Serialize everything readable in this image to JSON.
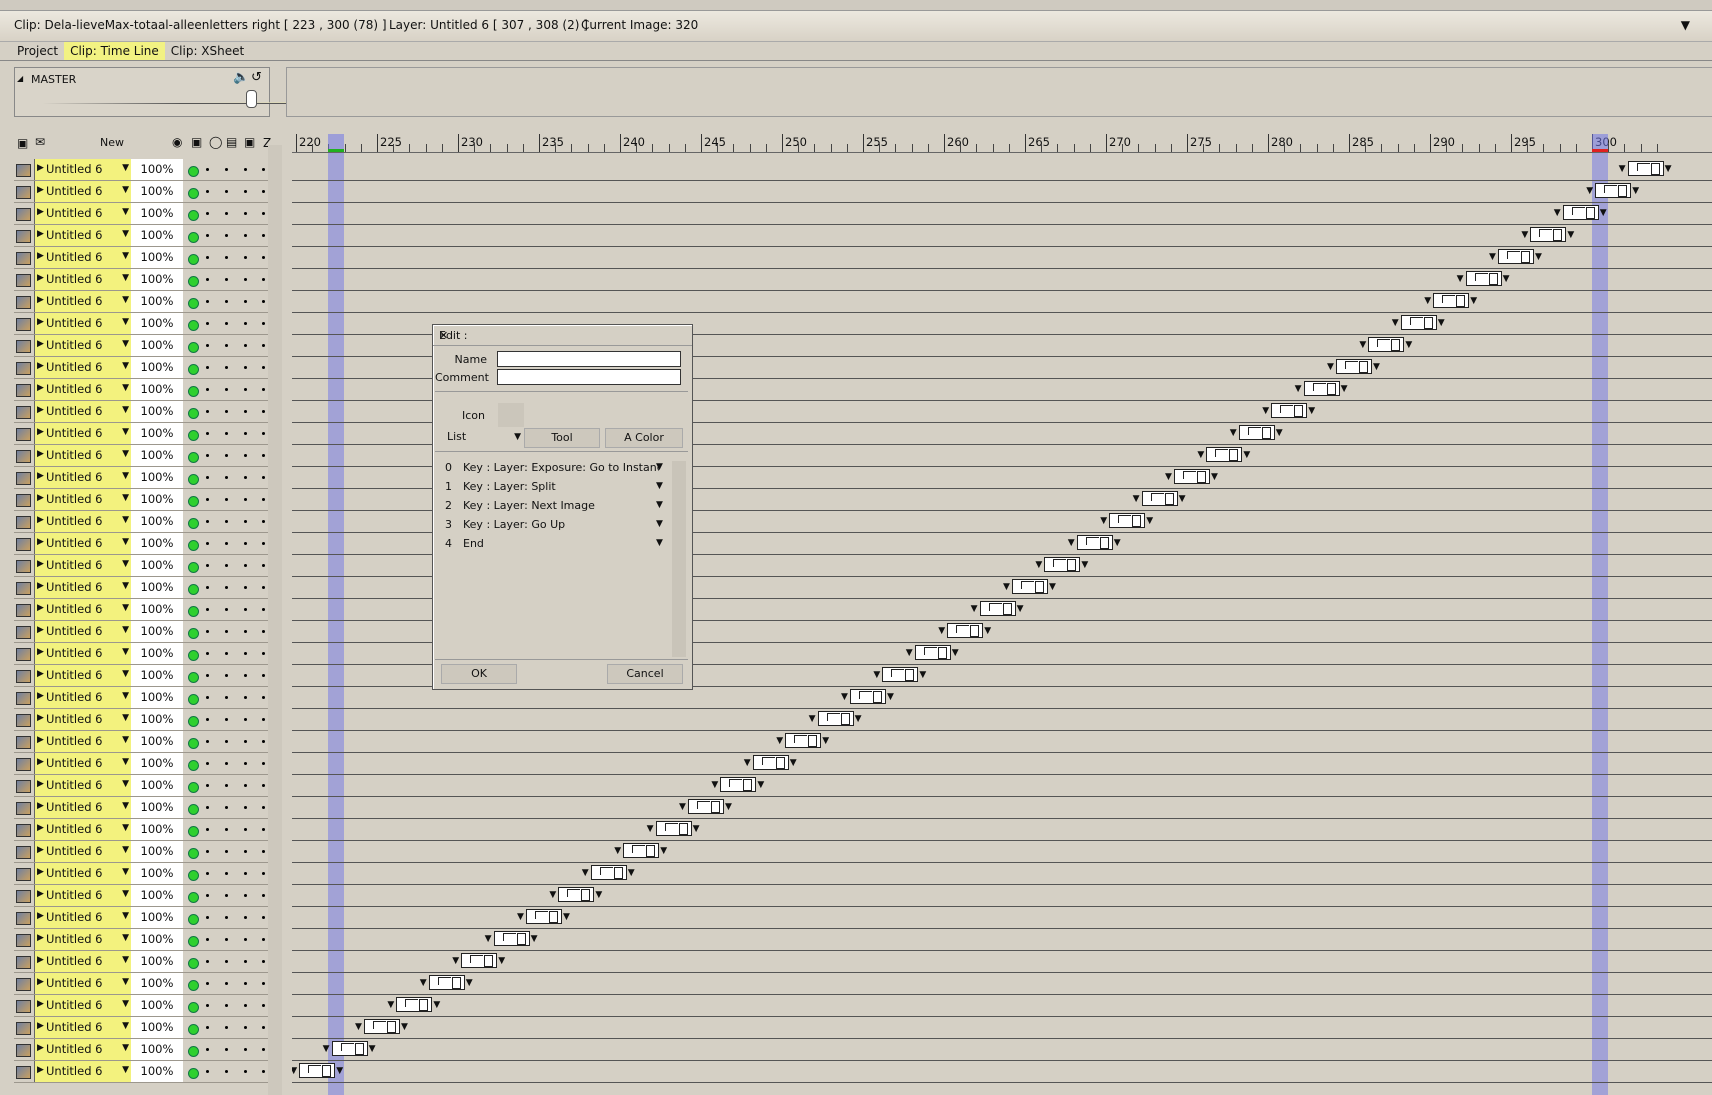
{
  "titlebar": {
    "clip": "Clip: Dela-lieveMax-totaal-alleenletters right [ 223 , 300  (78) ]",
    "layer": "Layer: Untitled 6 [ 307 , 308  (2) ]",
    "current_image": "Current Image: 320"
  },
  "tabs": [
    "Project",
    "Clip: Time Line",
    "Clip: XSheet"
  ],
  "active_tab": 1,
  "master": {
    "label": "MASTER",
    "volume": 1.0
  },
  "layer_header": {
    "new_label": "New",
    "z_label": "Z"
  },
  "layer_row": {
    "name": "Untitled 6",
    "opacity": "100%"
  },
  "layer_count": 42,
  "ruler": {
    "start": 220,
    "end": 300,
    "step": 5,
    "labels": [
      "220",
      "225",
      "230",
      "235",
      "240",
      "245",
      "250",
      "255",
      "260",
      "265",
      "270",
      "275",
      "280",
      "285",
      "290",
      "295",
      "300"
    ]
  },
  "markers": {
    "in_frame": 222,
    "out_frame": 300,
    "in_color": "#20b020",
    "out_color": "#e02020",
    "band_color": "#6f74e8"
  },
  "dialog": {
    "title": "Edit :",
    "name_label": "Name",
    "comment_label": "Comment",
    "name_value": "",
    "comment_value": "",
    "icon_label": "Icon",
    "list_label": "List",
    "tool_label": "Tool",
    "acolor_label": "A Color",
    "actions": [
      {
        "num": "0",
        "text": "Key : Layer: Exposure: Go to Instance T"
      },
      {
        "num": "1",
        "text": "Key : Layer: Split"
      },
      {
        "num": "2",
        "text": "Key : Layer: Next Image"
      },
      {
        "num": "3",
        "text": "Key : Layer: Go Up"
      },
      {
        "num": "4",
        "text": "End"
      }
    ],
    "ok_label": "OK",
    "cancel_label": "Cancel"
  },
  "colors": {
    "layer_name_bg": "#f3f27e",
    "active_tab_bg": "#f2f282",
    "visible_dot": "#2fd02f"
  }
}
